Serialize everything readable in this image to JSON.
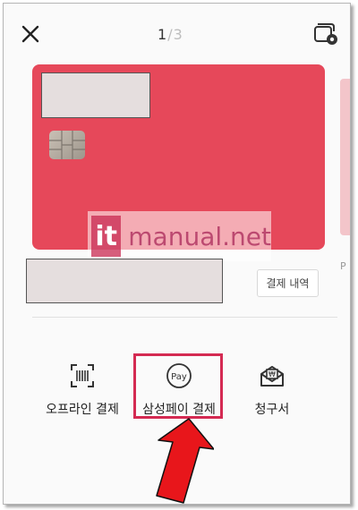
{
  "header": {
    "close_icon": "close-icon",
    "pager_current": "1",
    "pager_separator": "/",
    "pager_total": "3",
    "settings_icon": "card-settings-icon"
  },
  "card": {
    "color": "#e6485a"
  },
  "next_card_label": "P",
  "watermark": {
    "logo": "it",
    "text": "manual.net"
  },
  "history_button": "결제 내역",
  "actions": [
    {
      "icon": "barcode-scan-icon",
      "label": "오프라인 결제"
    },
    {
      "icon": "pay-icon",
      "icon_text": "Pay",
      "label": "삼성페이 결제"
    },
    {
      "icon": "invoice-icon",
      "label": "청구서"
    }
  ],
  "colors": {
    "highlight": "#d42a52",
    "arrow": "#e8161b"
  }
}
